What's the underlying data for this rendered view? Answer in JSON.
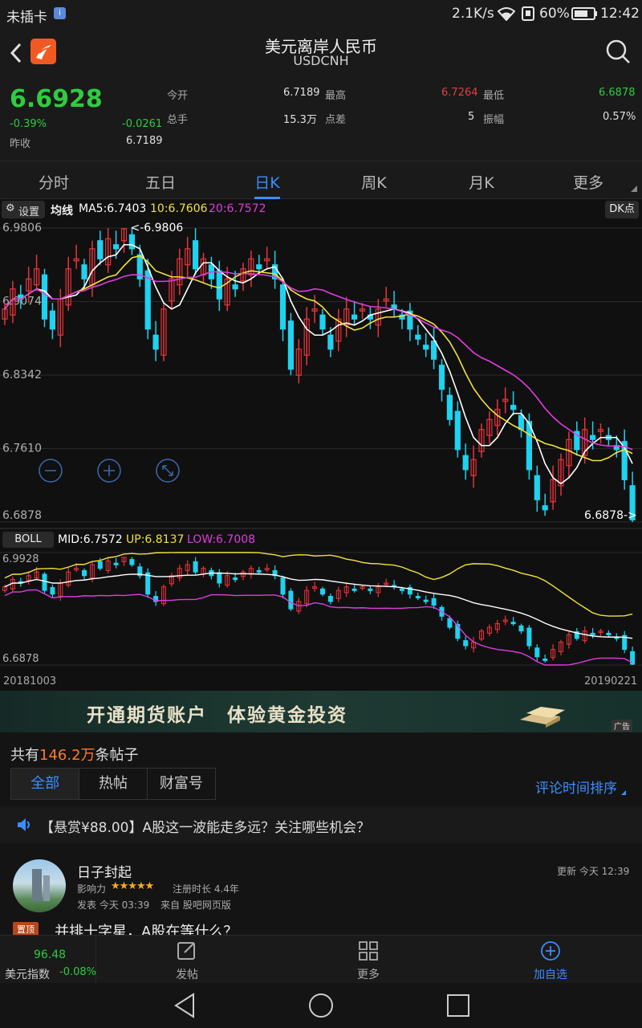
{
  "status_bar": {
    "carrier": "未插卡",
    "speed": "2.1K/s",
    "battery": "60%",
    "time": "12:42"
  },
  "header": {
    "title": "美元离岸人民币",
    "subtitle": "USDCNH"
  },
  "quote": {
    "price": "6.6928",
    "change_pct": "-0.39%",
    "change": "-0.0261",
    "prev_close_label": "昨收",
    "prev_close": "6.7189",
    "open_label": "今开",
    "open": "6.7189",
    "high_label": "最高",
    "high": "6.7264",
    "low_label": "最低",
    "low": "6.6878",
    "volume_label": "总手",
    "volume": "15.3万",
    "spread_label": "点差",
    "spread": "5",
    "amplitude_label": "振幅",
    "amplitude": "0.57%"
  },
  "period_tabs": [
    "分时",
    "五日",
    "日K",
    "周K",
    "月K",
    "更多"
  ],
  "active_tab": "日K",
  "chart_toolbar": {
    "settings": "设置",
    "ma_label": "均线",
    "ma5": "MA5:6.7403",
    "ma10": "10:6.7606",
    "ma20": "20:6.7572",
    "dk_button": "DK点"
  },
  "colors": {
    "up": "#e8343a",
    "down": "#1ed2f0",
    "ma5": "#ffffff",
    "ma10": "#f2e23a",
    "ma20": "#e03ce0",
    "price_green": "#2ecc40",
    "accent_blue": "#3a8eff",
    "orange": "#ff7a2a"
  },
  "chart_data": [
    {
      "type": "candlestick",
      "y_ticks": [
        "6.9806",
        "6.9074",
        "6.8342",
        "6.7610",
        "6.6878"
      ],
      "ylim": [
        6.6878,
        6.9806
      ],
      "max_annotation": "<-6.9806",
      "min_annotation": "6.6878->",
      "ma_lines": [
        "MA5",
        "MA10",
        "MA20"
      ],
      "close_series": [
        6.9,
        6.92,
        6.91,
        6.93,
        6.94,
        6.89,
        6.88,
        6.91,
        6.94,
        6.95,
        6.93,
        6.96,
        6.95,
        6.97,
        6.96,
        6.98,
        6.96,
        6.93,
        6.88,
        6.86,
        6.9,
        6.93,
        6.95,
        6.96,
        6.94,
        6.95,
        6.93,
        6.91,
        6.93,
        6.92,
        6.94,
        6.95,
        6.94,
        6.95,
        6.93,
        6.88,
        6.84,
        6.86,
        6.89,
        6.9,
        6.88,
        6.86,
        6.89,
        6.9,
        6.89,
        6.9,
        6.89,
        6.9,
        6.91,
        6.9,
        6.89,
        6.88,
        6.87,
        6.86,
        6.85,
        6.82,
        6.79,
        6.76,
        6.74,
        6.75,
        6.78,
        6.79,
        6.8,
        6.81,
        6.8,
        6.78,
        6.74,
        6.71,
        6.7,
        6.73,
        6.75,
        6.77,
        6.76,
        6.78,
        6.77,
        6.78,
        6.77,
        6.76,
        6.73,
        6.69
      ],
      "x_start": "20181003",
      "x_end": "20190221"
    },
    {
      "type": "line",
      "indicator": "BOLL",
      "labels": {
        "mid": "MID:6.7572",
        "up": "UP:6.8137",
        "low": "LOW:6.7008"
      },
      "y_ticks": [
        "6.9928",
        "6.6878"
      ],
      "ylim": [
        6.6878,
        6.9928
      ]
    }
  ],
  "ad": {
    "text": "开通期货账户　体验黄金投资",
    "badge": "广告"
  },
  "posts": {
    "count_prefix": "共有",
    "count": "146.2万",
    "count_suffix": "条帖子",
    "filters": [
      "全部",
      "热帖",
      "财富号"
    ],
    "active_filter": "全部",
    "sort": "评论时间排序",
    "announcement": "【悬赏¥88.00】A股这一波能走多远？关注哪些机会？",
    "post": {
      "user": "日子封起",
      "influence_label": "影响力",
      "stars": "★★★★★",
      "reg_label": "注册时长 4.4年",
      "posted": "发表 今天 03:39",
      "source": "来自 股吧网页版",
      "updated": "更新 今天 12:39",
      "pin_tag": "置顶",
      "title": "并排十字星，A股在等什么？"
    }
  },
  "bottom_bar": {
    "index_value": "96.48",
    "index_name": "美元指数",
    "index_change": "-0.08%",
    "post_label": "发帖",
    "more_label": "更多",
    "add_label": "加自选"
  }
}
